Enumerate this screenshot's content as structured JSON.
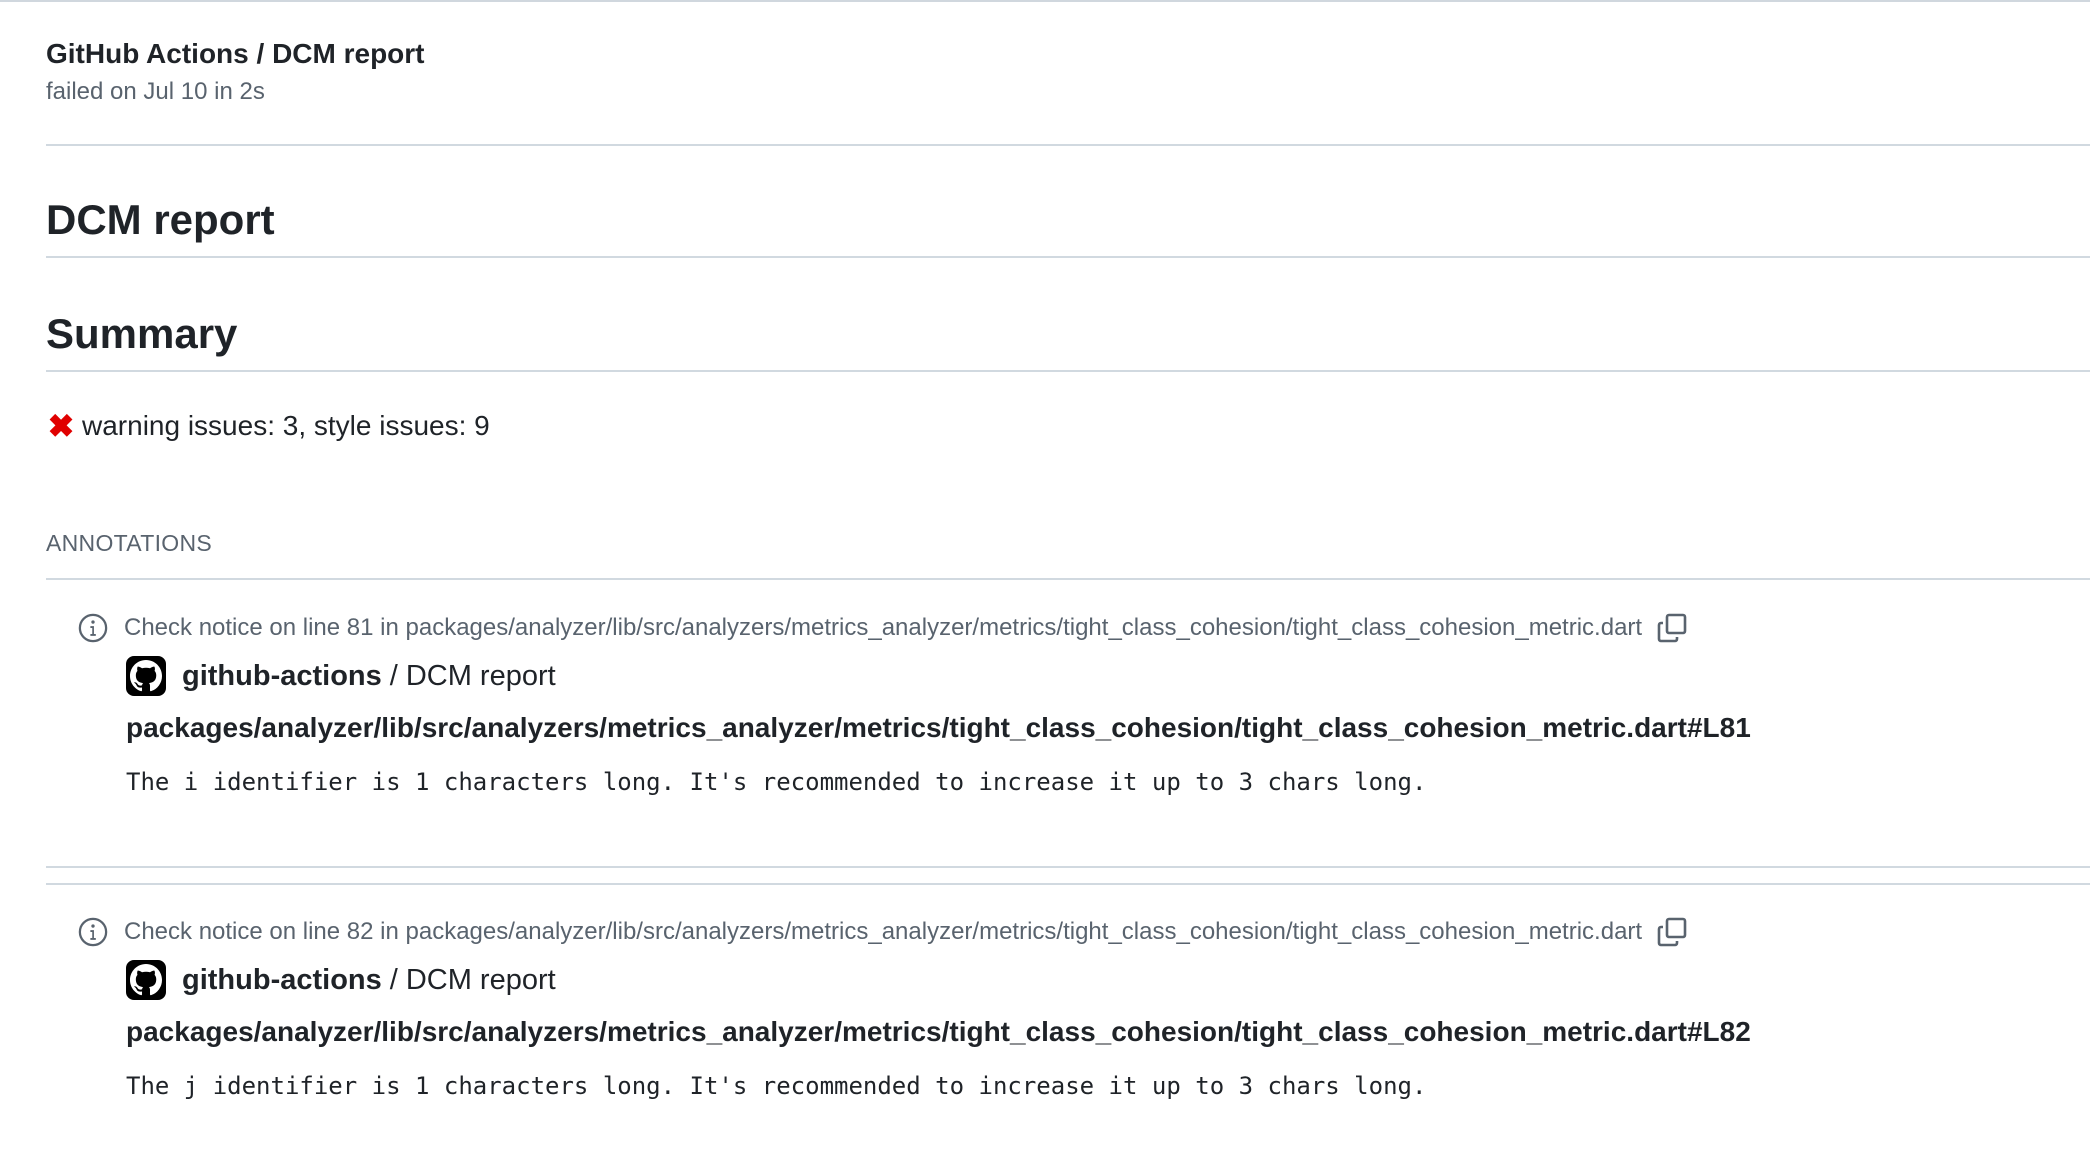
{
  "header": {
    "title": "GitHub Actions / DCM report",
    "subtitle": "failed on Jul 10 in 2s"
  },
  "report": {
    "title": "DCM report",
    "summary_heading": "Summary",
    "summary_icon": "x-icon",
    "summary_text": "warning issues: 3, style issues: 9",
    "summary_icon_color": "#e00000"
  },
  "annotations": {
    "label": "ANNOTATIONS",
    "items": [
      {
        "icon": "info-icon",
        "notice": "Check notice on line 81 in packages/analyzer/lib/src/analyzers/metrics_analyzer/metrics/tight_class_cohesion/tight_class_cohesion_metric.dart",
        "author": "github-actions",
        "separator": "/",
        "app": "DCM report",
        "path": "packages/analyzer/lib/src/analyzers/metrics_analyzer/metrics/tight_class_cohesion/tight_class_cohesion_metric.dart#L81",
        "message": "The i identifier is 1 characters long. It's recommended to increase it up to 3 chars long."
      },
      {
        "icon": "info-icon",
        "notice": "Check notice on line 82 in packages/analyzer/lib/src/analyzers/metrics_analyzer/metrics/tight_class_cohesion/tight_class_cohesion_metric.dart",
        "author": "github-actions",
        "separator": "/",
        "app": "DCM report",
        "path": "packages/analyzer/lib/src/analyzers/metrics_analyzer/metrics/tight_class_cohesion/tight_class_cohesion_metric.dart#L82",
        "message": "The j identifier is 1 characters long. It's recommended to increase it up to 3 chars long."
      }
    ]
  }
}
